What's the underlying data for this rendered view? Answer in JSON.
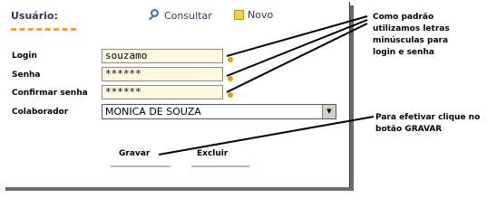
{
  "form": {
    "title": "Usuário:",
    "toolbar": {
      "consult_label": "Consultar",
      "new_label": "Novo"
    },
    "fields": [
      {
        "label": "Login",
        "value": "souzamo"
      },
      {
        "label": "Senha",
        "value": "******"
      },
      {
        "label": "Confirmar senha",
        "value": "******"
      }
    ],
    "collaborator": {
      "label": "Colaborador",
      "selected": "MONICA DE SOUZA"
    },
    "buttons": {
      "save_label": "Gravar",
      "delete_label": "Excluir"
    }
  },
  "annotations": {
    "note1_line1": "Como padrão",
    "note1_line2": "utilizamos letras",
    "note1_line3": "minúsculas para",
    "note1_line4": "login e senha",
    "note2_line1": "Para efetivar clique no",
    "note2_line2": "botão GRAVAR"
  },
  "colors": {
    "title": "#333366",
    "underline_accent": "#f0a030",
    "input_bg": "#fff8e0",
    "required_dot": "#e0a000"
  }
}
